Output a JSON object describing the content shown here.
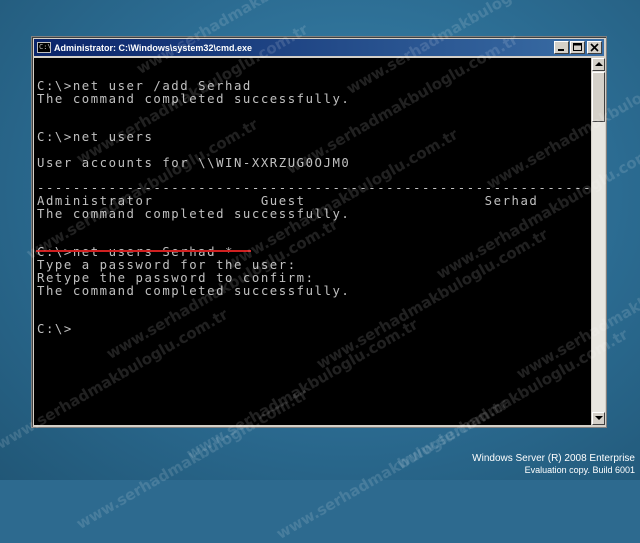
{
  "window": {
    "title": "Administrator: C:\\Windows\\system32\\cmd.exe",
    "icon_glyph": "C:\\"
  },
  "console": {
    "lines": [
      "",
      "C:\\>net user /add Serhad",
      "The command completed successfully.",
      "",
      "",
      "C:\\>net users",
      "",
      "User accounts for \\\\WIN-XXRZUG0OJM0",
      "",
      "-------------------------------------------------------------------------------",
      "Administrator            Guest                    Serhad",
      "The command completed successfully.",
      "",
      "",
      "C:\\>net users Serhad *",
      "Type a password for the user:",
      "Retype the password to confirm:",
      "The command completed successfully.",
      "",
      "",
      "C:\\>"
    ]
  },
  "watermark": {
    "text": "www.serhadmakbuloglu.com.tr"
  },
  "branding": {
    "line1": "Windows Server (R) 2008 Enterprise",
    "line2": "Evaluation copy. Build 6001"
  },
  "colors": {
    "console_bg": "#000000",
    "console_text": "#c0c0c0",
    "title_gradient_start": "#0a246a",
    "desktop": "#2d6a8f",
    "underline_accent": "#d02020"
  },
  "icons": [
    "cmd-icon",
    "minimize-icon",
    "maximize-icon",
    "close-icon",
    "scroll-up-icon",
    "scroll-down-icon"
  ]
}
